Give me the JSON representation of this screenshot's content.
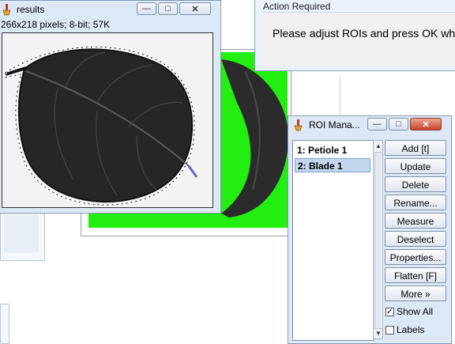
{
  "results_window": {
    "title": "results",
    "image_info": "266x218 pixels; 8-bit; 57K",
    "buttons": {
      "minimize": "—",
      "maximize": "□",
      "close": "✕"
    }
  },
  "action_window": {
    "title": "Action Required",
    "message": "Please adjust ROIs and press OK wh"
  },
  "roi_manager": {
    "title": "ROI Mana...",
    "buttons": {
      "minimize": "—",
      "maximize": "□",
      "close": "✕"
    },
    "items": [
      {
        "label": "1: Petiole 1",
        "selected": false
      },
      {
        "label": "2: Blade 1",
        "selected": true
      }
    ],
    "actions": [
      "Add [t]",
      "Update",
      "Delete",
      "Rename...",
      "Measure",
      "Deselect",
      "Properties...",
      "Flatten [F]",
      "More »"
    ],
    "show_all_label": "Show All",
    "show_all_checked": true,
    "labels_label": "Labels",
    "labels_checked": false
  },
  "colors": {
    "highlight_green": "#22ee11",
    "leaf_dark": "#2a2a2a",
    "window_frame": "#dde8f6",
    "close_red": "#c9442b"
  },
  "icons": [
    "imagej-icon",
    "minimize-icon",
    "maximize-icon",
    "close-icon",
    "checkbox-icon",
    "scroll-up-icon",
    "scroll-down-icon"
  ]
}
